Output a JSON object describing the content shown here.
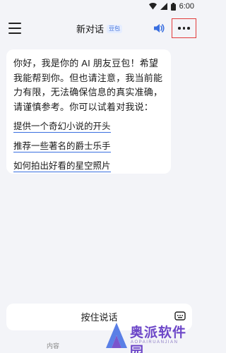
{
  "status_bar": {
    "time": "6:00",
    "icons": [
      "wifi-icon",
      "signal-icon",
      "battery-icon"
    ]
  },
  "header": {
    "title": "新对话",
    "badge": "豆包",
    "icons": [
      "menu-icon",
      "speaker-icon",
      "more-icon"
    ],
    "accent_color": "#3a6fe0",
    "highlight_color": "#e23b3b"
  },
  "chat": {
    "greeting": "你好，我是你的 AI 朋友豆包！希望我能帮到你。但也请注意，我当前能力有限，无法确保信息的真实准确，请谨慎参考。你可以试着对我说：",
    "suggestions": [
      "提供一个奇幻小说的开头",
      "推荐一些著名的爵士乐手",
      "如何拍出好看的星空照片"
    ]
  },
  "input_bar": {
    "label": "按住说话",
    "icon": "keyboard-icon"
  },
  "footer": {
    "disclaimer": "内容"
  },
  "watermark": {
    "text": "奥派软件园",
    "sub": "AOPAIRUANJIAN"
  }
}
